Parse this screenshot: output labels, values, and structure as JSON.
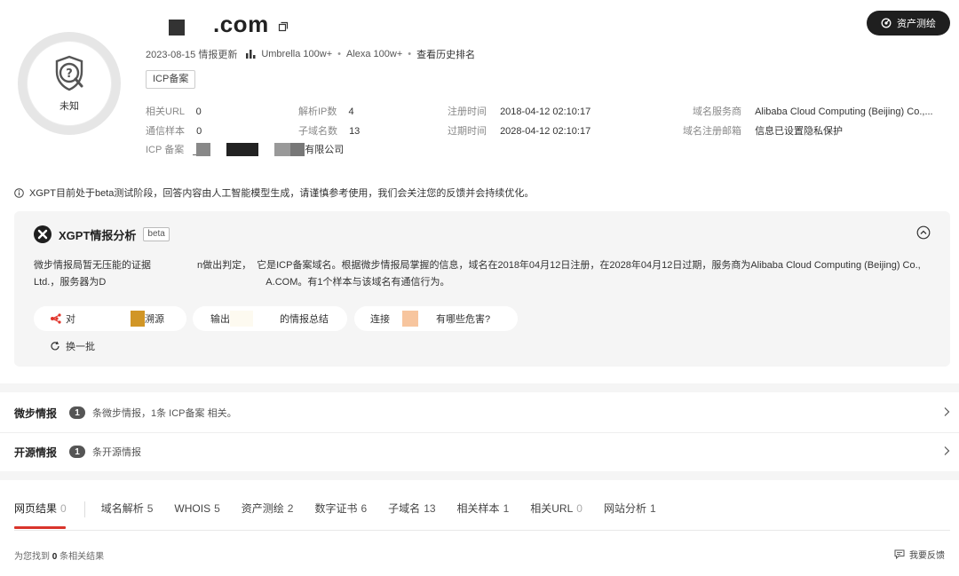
{
  "verdict": {
    "label": "未知",
    "icon": "unknown-threat-icon"
  },
  "domain": {
    "text": ".com",
    "copy_icon": "copy-icon"
  },
  "meta": {
    "date": "2023-08-15 情报更新",
    "umbrella": "Umbrella 100w+",
    "sep1": "•",
    "alexa": "Alexa 100w+",
    "sep2": "•",
    "history": "查看历史排名"
  },
  "icp_tag": "ICP备案",
  "details": {
    "related_url": {
      "label": "相关URL",
      "value": "0"
    },
    "comm_samples": {
      "label": "通信样本",
      "value": "0"
    },
    "resolved_ips": {
      "label": "解析IP数",
      "value": "4"
    },
    "subdomains": {
      "label": "子域名数",
      "value": "13"
    },
    "reg_time": {
      "label": "注册时间",
      "value": "2018-04-12 02:10:17"
    },
    "exp_time": {
      "label": "过期时间",
      "value": "2028-04-12 02:10:17"
    },
    "registrar": {
      "label": "域名服务商",
      "value": "Alibaba Cloud Computing (Beijing) Co.,..."
    },
    "reg_email": {
      "label": "域名注册邮箱",
      "value": "信息已设置隐私保护"
    },
    "icp": {
      "label": "ICP 备案",
      "suffix": "有限公司"
    }
  },
  "assets_button": "资产测绘",
  "notice": "XGPT目前处于beta测试阶段，回答内容由人工智能模型生成，请谨慎参考使用，我们会关注您的反馈并会持续优化。",
  "ai": {
    "title": "XGPT情报分析",
    "beta": "beta",
    "line1_a": "微步情报局暂无压能的证据",
    "line1_b": "n做出判定，",
    "line1_c": "它是ICP备案域名。根据微步情报局掌握的信息，域名在2018年04月12日注册，在2028年04月12日过期，服务商为Alibaba Cloud Computing (Beijing) Co.,",
    "line2_a": "Ltd.，服务器为D",
    "line2_b": "A.COM。有1个样本与该域名有通信行为。",
    "chip1_a": "对",
    "chip1_b": "溯源",
    "chip2_a": "输出",
    "chip2_b": "的情报总结",
    "chip3_a": "连接",
    "chip3_b": "有哪些危害?",
    "refresh": "换一批"
  },
  "intel": [
    {
      "label": "微步情报",
      "count": "1",
      "text": "条微步情报，1条 ICP备案 相关。"
    },
    {
      "label": "开源情报",
      "count": "1",
      "text": "条开源情报"
    }
  ],
  "tabs": [
    {
      "label": "网页结果",
      "count": "0"
    },
    {
      "label": "域名解析",
      "count": "5"
    },
    {
      "label": "WHOIS",
      "count": "5"
    },
    {
      "label": "资产测绘",
      "count": "2"
    },
    {
      "label": "数字证书",
      "count": "6"
    },
    {
      "label": "子域名",
      "count": "13"
    },
    {
      "label": "相关样本",
      "count": "1"
    },
    {
      "label": "相关URL",
      "count": "0"
    },
    {
      "label": "网站分析",
      "count": "1"
    }
  ],
  "results": {
    "prefix": "为您找到",
    "count": "0",
    "suffix": "条相关结果"
  },
  "feedback": "我要反馈",
  "colors": {
    "accent": "#d9342b",
    "dark_button": "#1f1f1f",
    "card_bg": "#f5f5f5"
  }
}
